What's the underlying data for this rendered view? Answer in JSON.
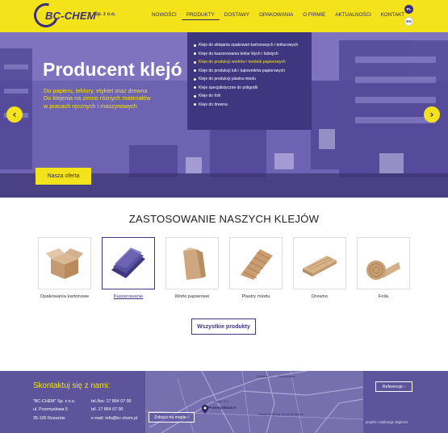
{
  "header": {
    "logo_name": "BC-CHEM",
    "logo_suffix": "Sp. z o.o.",
    "nav": [
      "NOWOŚCI",
      "PRODUKTY",
      "DOSTAWY",
      "OPAKOWANIA",
      "O FIRMIE",
      "AKTUALNOŚCI",
      "KONTAKT"
    ],
    "active_nav": "PRODUKTY",
    "lang_pl": "PL",
    "lang_en": "EN",
    "accent": "#f4e21b",
    "brand": "#3f3680"
  },
  "dropdown": {
    "items": [
      "Kleje do sklejania opakowań kartonowych i tekturowych",
      "Kleje do kaszerowania tektur litych i falistych",
      "Kleje do produkcji worków i torebek papierowych",
      "Kleje do produkcji tub i kątowników papierowych",
      "Kleje do produkcji plastra miodu",
      "Kleje specjalistyczne do poligrafii",
      "Kleje do folii",
      "Kleje do drewna"
    ],
    "active_index": 2
  },
  "hero": {
    "title": "Producent klejó",
    "subtitle": [
      "Do papieru, tektury, etykiet oraz drewna",
      "Do klejenia na zimno różnych materiałów",
      "w pracach ręcznych i maszynowych"
    ],
    "button": "Nasza oferta",
    "prev": "‹",
    "next": "›"
  },
  "section": {
    "title": "ZASTOSOWANIE NASZYCH KLEJÓW",
    "products": [
      "Opakowania kartonowe",
      "Kaszerowanie",
      "Worki papierowe",
      "Plastry miodu",
      "Drewno",
      "Folia"
    ],
    "active_index": 1,
    "all_button": "Wszystkie produkty"
  },
  "footer": {
    "title": "Skontaktuj się z nami:",
    "address": [
      "\"BC-CHEM\" Sp. z o.o.",
      "ul. Przemysłowa 5",
      "35-105 Rzeszów"
    ],
    "phones": [
      "tel./fax: 17 864 07 00",
      "tel. 17 864 07 00",
      "e-mail: info@bc-chem.pl"
    ],
    "map_button": "Zobacz na mapie",
    "ref_button": "Referencje",
    "credit": "projekt i realizacja: BigCom",
    "pin_label": "Przemysłowa 5",
    "map_labels": [
      "Drzelów",
      "Stacja paliw",
      "Rajpol S.A.",
      "Stacja Kolejowa Rzeszów Staroń"
    ]
  }
}
